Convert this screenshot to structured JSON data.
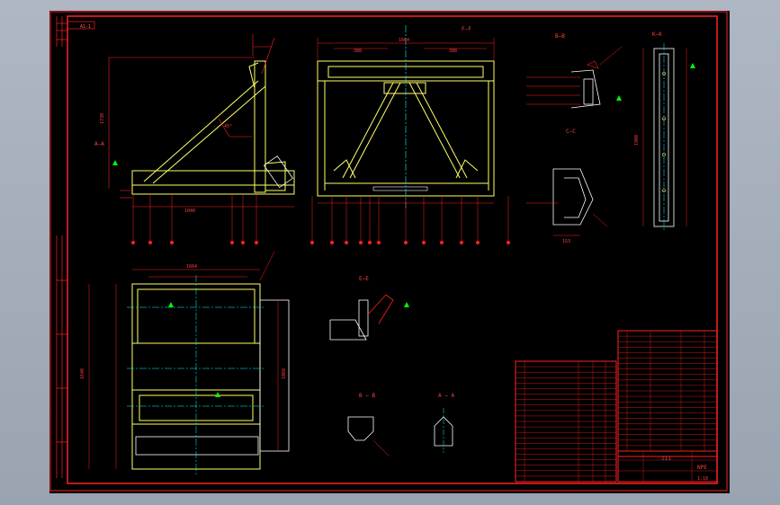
{
  "drawing": {
    "top_left_tag": "A1-1",
    "labels": {
      "section_bb": "B—B",
      "section_cc": "C—C",
      "view_ff": "F—F",
      "view_aa": "A—A",
      "view_kk": "K—K",
      "view_bb_small": "B — B",
      "view_aa_small": "A — A",
      "view_ee": "E—E",
      "dim_top_front": "1664",
      "dim_top_mid_left": "388",
      "dim_top_mid_right": "388",
      "dim_width_plan": "1664",
      "dim_side_height": "1730",
      "dim_side_base": "1048",
      "dim_plan_left": "1640",
      "dim_plan_right": "1060",
      "dim_cc_width": "153",
      "dim_kk_total": "1900",
      "angle_side": "45°"
    },
    "title_block": {
      "drawing_number": "111",
      "sheet_code": "NPE",
      "scale": "1:10"
    },
    "colors": {
      "sheet_bg": "#000000",
      "frame": "#ff2020",
      "part_line": "#ffff66",
      "centerline": "#00ffff",
      "hidden": "#ffffff",
      "weld_symbol": "#00ff00"
    }
  }
}
